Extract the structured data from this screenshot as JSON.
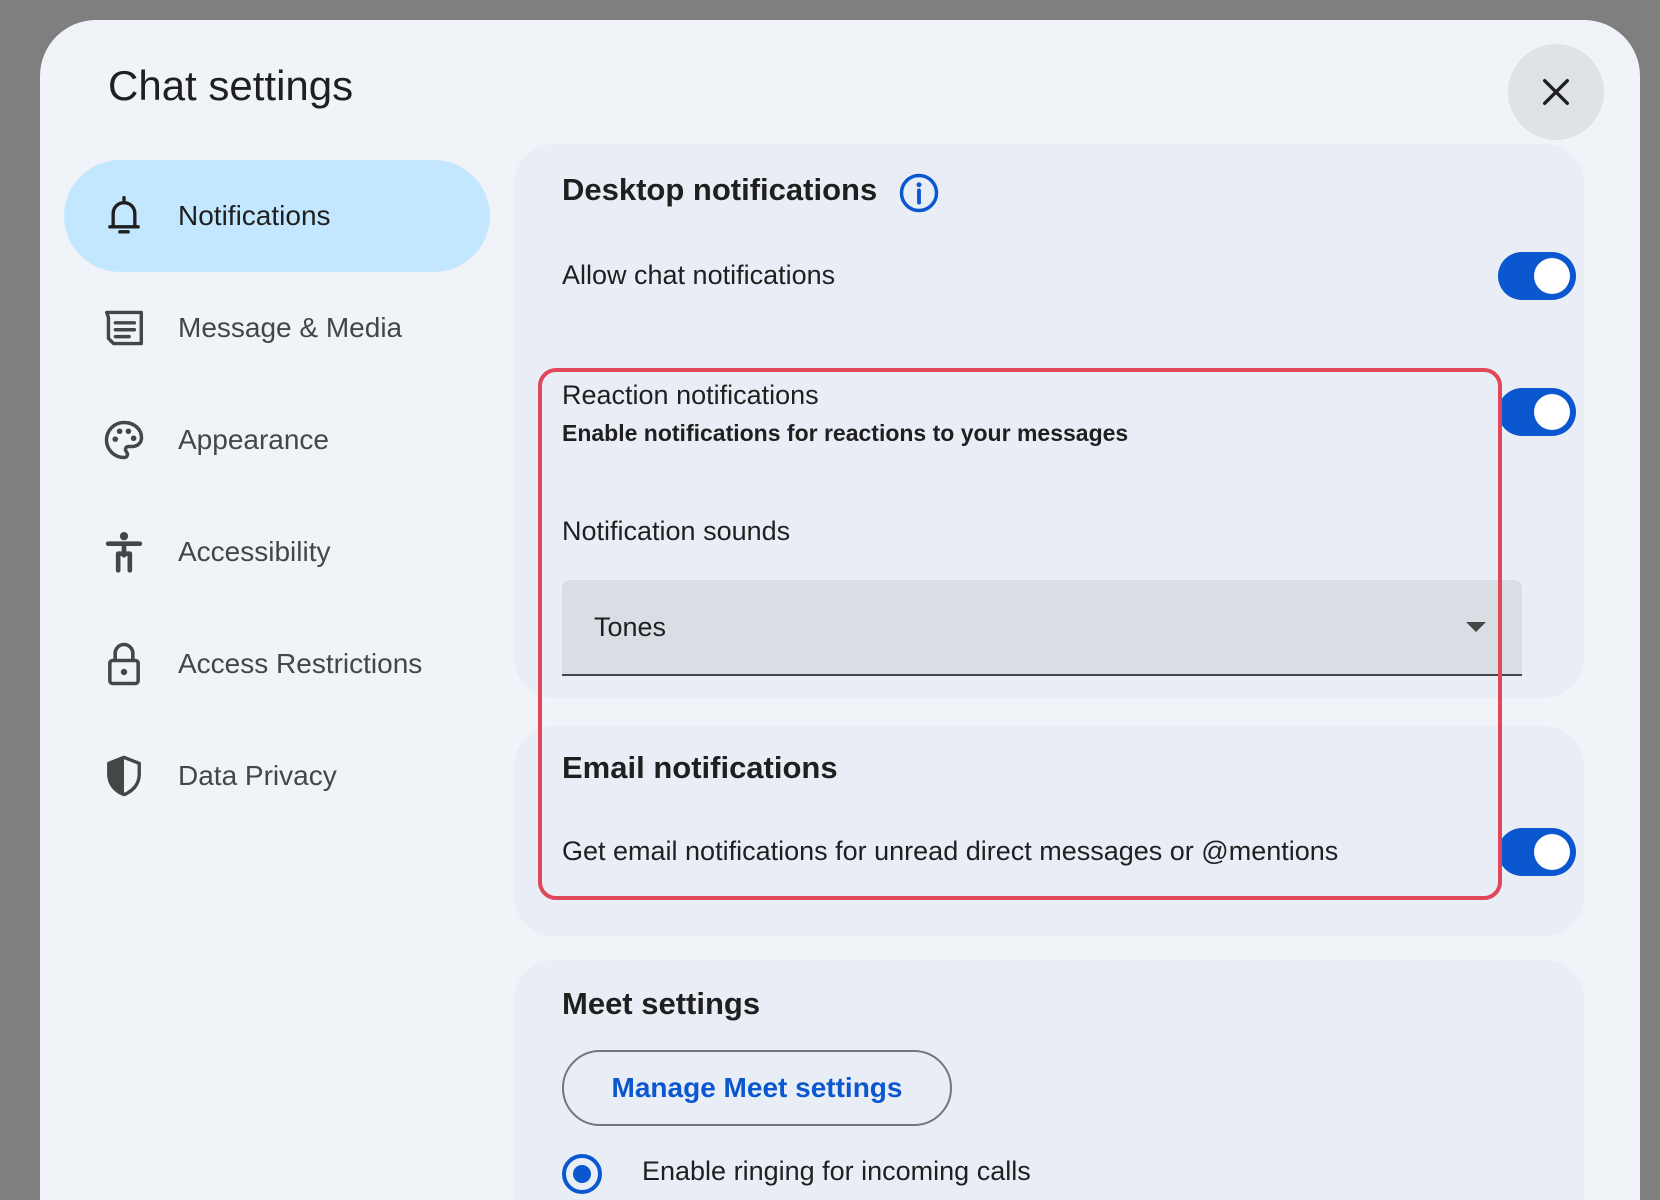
{
  "dialog": {
    "title": "Chat settings",
    "close_icon": "close-icon"
  },
  "nav": {
    "items": [
      {
        "label": "Notifications",
        "icon": "bell-icon",
        "active": true
      },
      {
        "label": "Message & Media",
        "icon": "message-media-icon",
        "active": false
      },
      {
        "label": "Appearance",
        "icon": "palette-icon",
        "active": false
      },
      {
        "label": "Accessibility",
        "icon": "accessibility-icon",
        "active": false
      },
      {
        "label": "Access Restrictions",
        "icon": "lock-icon",
        "active": false
      },
      {
        "label": "Data Privacy",
        "icon": "shield-icon",
        "active": false
      }
    ]
  },
  "desktop": {
    "heading": "Desktop notifications",
    "info_icon": "info-icon",
    "allow_label": "Allow chat notifications",
    "allow_on": true,
    "reaction_label": "Reaction notifications",
    "reaction_sub": "Enable notifications for reactions to your messages",
    "reaction_on": true,
    "sounds_label": "Notification sounds",
    "sounds_value": "Tones"
  },
  "email": {
    "heading": "Email notifications",
    "unread_label": "Get email notifications for unread direct messages or @mentions",
    "unread_on": true
  },
  "meet": {
    "heading": "Meet settings",
    "manage_button": "Manage Meet settings",
    "ringing_label": "Enable ringing for incoming calls",
    "ringing_selected": true
  },
  "colors": {
    "accent": "#0b57d0",
    "active_nav": "#c2e7ff",
    "highlight": "#e04859",
    "background": "#f0f4f9"
  }
}
